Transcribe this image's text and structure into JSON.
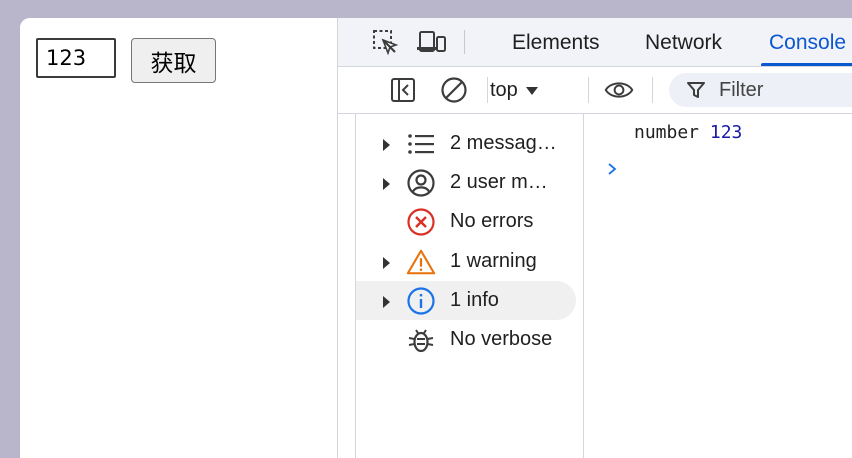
{
  "page": {
    "input_value": "123",
    "button_label": "获取"
  },
  "devtools": {
    "tabs": [
      {
        "label": "Elements"
      },
      {
        "label": "Network"
      },
      {
        "label": "Console"
      }
    ],
    "active_tab": "Console",
    "toolbar": {
      "context": "top",
      "filter_placeholder": "Filter"
    },
    "sidebar": {
      "items": [
        {
          "label": "2 messag…",
          "icon": "list-icon"
        },
        {
          "label": "2 user m…",
          "icon": "user-icon"
        },
        {
          "label": "No errors",
          "icon": "error-icon"
        },
        {
          "label": "1 warning",
          "icon": "warning-icon"
        },
        {
          "label": "1 info",
          "icon": "info-icon"
        },
        {
          "label": "No verbose",
          "icon": "bug-icon"
        }
      ]
    },
    "console": {
      "log_type": "number",
      "log_value": "123"
    },
    "colors": {
      "accent": "#0b57d0",
      "error": "#d93025",
      "warning": "#e8710a",
      "info": "#1a73e8"
    }
  }
}
